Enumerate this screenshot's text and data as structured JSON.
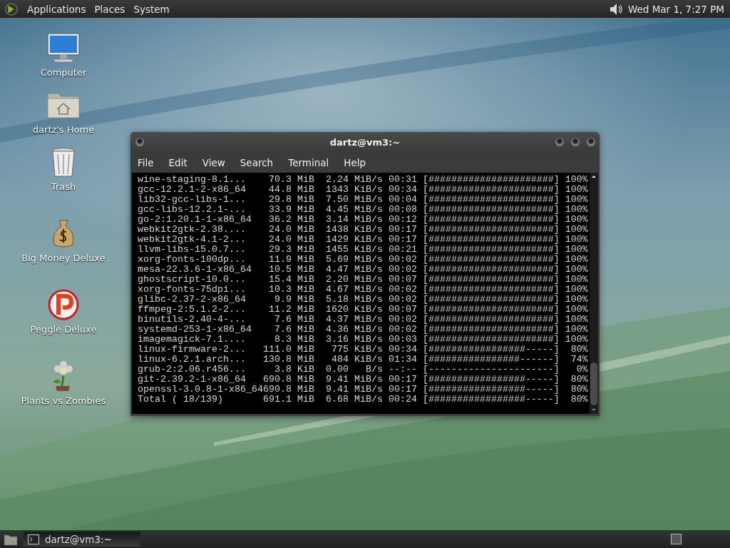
{
  "top_panel": {
    "menus": [
      "Applications",
      "Places",
      "System"
    ],
    "clock": "Wed Mar 1, 7:27 PM"
  },
  "desktop_icons": [
    {
      "kind": "computer",
      "label": "Computer"
    },
    {
      "kind": "home",
      "label": "dartz's Home"
    },
    {
      "kind": "trash",
      "label": "Trash"
    },
    {
      "kind": "money",
      "label": "Big Money Deluxe"
    },
    {
      "kind": "peggle",
      "label": "Peggle Deluxe"
    },
    {
      "kind": "plant",
      "label": "Plants vs Zombies"
    }
  ],
  "terminal": {
    "title": "dartz@vm3:~",
    "menu": [
      "File",
      "Edit",
      "View",
      "Search",
      "Terminal",
      "Help"
    ],
    "lines": [
      "wine-staging-8.1...    70.3 MiB  2.24 MiB/s 00:31 [######################] 100%",
      "gcc-12.2.1-2-x86_64    44.8 MiB  1343 KiB/s 00:34 [######################] 100%",
      "lib32-gcc-libs-1...    29.8 MiB  7.50 MiB/s 00:04 [######################] 100%",
      "gcc-libs-12.2.1-...    33.9 MiB  4.45 MiB/s 00:08 [######################] 100%",
      "go-2:1.20.1-1-x86_64   36.2 MiB  3.14 MiB/s 00:12 [######################] 100%",
      "webkit2gtk-2.38....    24.0 MiB  1438 KiB/s 00:17 [######################] 100%",
      "webkit2gtk-4.1-2...    24.0 MiB  1429 KiB/s 00:17 [######################] 100%",
      "llvm-libs-15.0.7...    29.3 MiB  1455 KiB/s 00:21 [######################] 100%",
      "xorg-fonts-100dp...    11.9 MiB  5.69 MiB/s 00:02 [######################] 100%",
      "mesa-22.3.6-1-x86_64   10.5 MiB  4.47 MiB/s 00:02 [######################] 100%",
      "ghostscript-10.0...    15.4 MiB  2.20 MiB/s 00:07 [######################] 100%",
      "xorg-fonts-75dpi...    10.3 MiB  4.67 MiB/s 00:02 [######################] 100%",
      "glibc-2.37-2-x86_64     9.9 MiB  5.18 MiB/s 00:02 [######################] 100%",
      "ffmpeg-2:5.1.2-2...    11.2 MiB  1620 KiB/s 00:07 [######################] 100%",
      "binutils-2.40-4-...     7.6 MiB  4.37 MiB/s 00:02 [######################] 100%",
      "systemd-253-1-x86_64    7.6 MiB  4.36 MiB/s 00:02 [######################] 100%",
      "imagemagick-7.1....     8.3 MiB  3.16 MiB/s 00:03 [######################] 100%",
      "linux-firmware-2...   111.0 MiB   775 KiB/s 00:34 [#################-----]  80%",
      "linux-6.2.1.arch...   130.8 MiB   484 KiB/s 01:34 [################------]  74%",
      "grub-2:2.06.r456...     3.8 KiB  0.00   B/s --:-- [----------------------]   0%",
      "git-2.39.2-1-x86_64   690.8 MiB  9.41 MiB/s 00:17 [#################-----]  80%",
      "openssl-3.0.8-1-x86_64690.8 MiB  9.41 MiB/s 00:17 [#################-----]  80%",
      "Total ( 18/139)       691.1 MiB  6.68 MiB/s 00:24 [#################-----]  80%"
    ]
  },
  "taskbar": {
    "tasks": [
      {
        "label": "dartz@vm3:~",
        "selected": true
      }
    ]
  }
}
